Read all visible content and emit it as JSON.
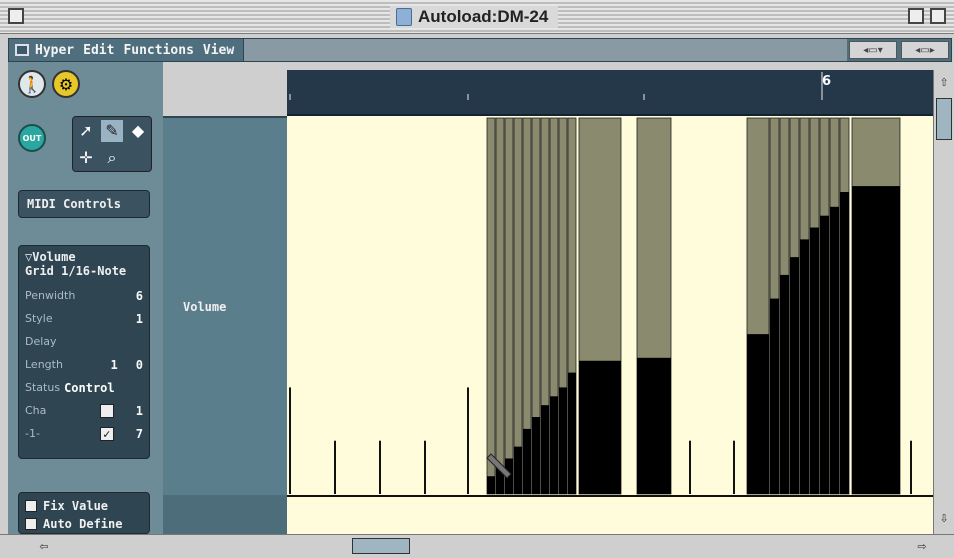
{
  "window": {
    "title": "Autoload:DM-24"
  },
  "menubar": {
    "items": [
      "Hyper",
      "Edit",
      "Functions",
      "View"
    ]
  },
  "leftpanel": {
    "out_label": "OUT",
    "midi_controls_label": "MIDI Controls",
    "info": {
      "header": "▽Volume",
      "grid": "Grid 1/16-Note",
      "penwidth_label": "Penwidth",
      "penwidth_value": "6",
      "style_label": "Style",
      "style_value": "1",
      "delay_label": "Delay",
      "length_label": "Length",
      "length_a": "1",
      "length_b": "0",
      "status_label": "Status",
      "status_value": "Control",
      "cha_label": "Cha",
      "cha_value": "1",
      "minus_label": "-1-",
      "minus_value": "7"
    },
    "fix_value_label": "Fix Value",
    "auto_define_label": "Auto Define"
  },
  "track_label": "Volume",
  "ruler": {
    "bar_number": "6"
  },
  "colors": {
    "bg_area": "#fffcdc",
    "bar_fill": "#8a8a6f",
    "value_fill": "#000000",
    "panel": "#5b7e8c"
  },
  "chart_data": {
    "type": "bar",
    "grid": "1/16-Note",
    "value_range": [
      0,
      127
    ],
    "events": [
      {
        "pos": 0,
        "value": 12
      },
      {
        "pos": 1,
        "value": 6
      },
      {
        "pos": 2,
        "value": 6
      },
      {
        "pos": 3,
        "value": 6
      },
      {
        "pos": 4,
        "value": 12
      },
      {
        "pos": 5,
        "value": 6
      },
      {
        "pos": 6,
        "value": 9
      },
      {
        "pos": 7,
        "value": 12
      },
      {
        "pos": 8,
        "value": 16
      },
      {
        "pos": 9,
        "value": 22
      },
      {
        "pos": 10,
        "value": 26
      },
      {
        "pos": 11,
        "value": 30
      },
      {
        "pos": 12,
        "value": 33
      },
      {
        "pos": 13,
        "value": 36
      },
      {
        "pos": 14,
        "value": 41
      },
      {
        "pos": 15,
        "value": 45
      },
      {
        "pos": 16,
        "value": 46
      },
      {
        "pos": 17,
        "value": 6
      },
      {
        "pos": 18,
        "value": 6
      },
      {
        "pos": 19,
        "value": 54
      },
      {
        "pos": 20,
        "value": 66
      },
      {
        "pos": 21,
        "value": 74
      },
      {
        "pos": 22,
        "value": 80
      },
      {
        "pos": 23,
        "value": 86
      },
      {
        "pos": 24,
        "value": 90
      },
      {
        "pos": 25,
        "value": 94
      },
      {
        "pos": 26,
        "value": 97
      },
      {
        "pos": 27,
        "value": 102
      },
      {
        "pos": 28,
        "value": 104
      },
      {
        "pos": 29,
        "value": 6
      }
    ]
  }
}
